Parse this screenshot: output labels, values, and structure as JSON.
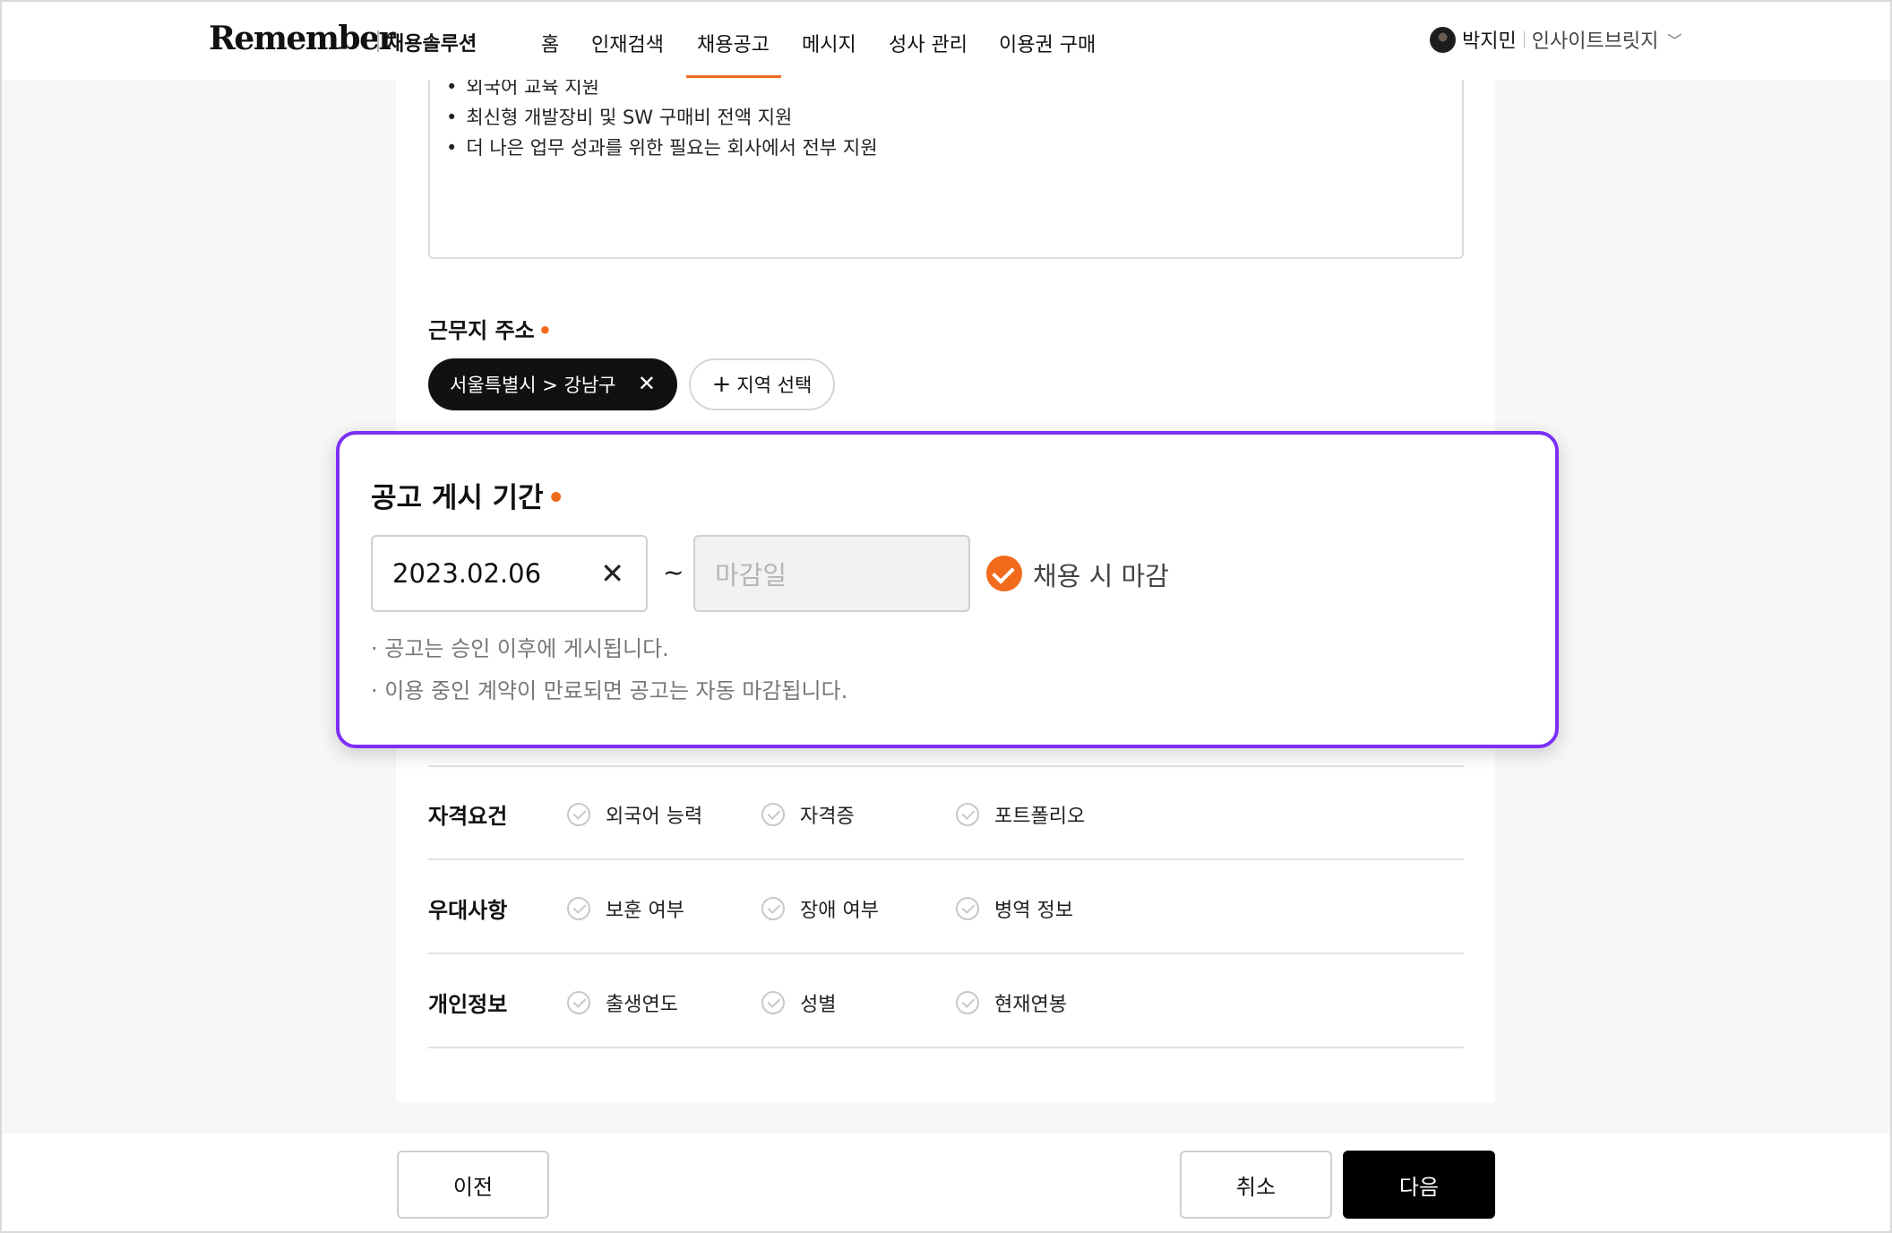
{
  "header": {
    "logo": "Remember",
    "logo_sub": "채용솔루션",
    "nav": [
      "홈",
      "인재검색",
      "채용공고",
      "메시지",
      "성사 관리",
      "이용권 구매"
    ],
    "active_nav": "채용공고",
    "user_name": "박지민",
    "company": "인사이트브릿지"
  },
  "benefits": [
    "외국어 교육 지원",
    "최신형 개발장비 및 SW 구매비 전액 지원",
    "더 나은 업무 성과를 위한 필요는 회사에서 전부 지원"
  ],
  "location": {
    "label": "근무지 주소",
    "selected_chip": "서울특별시 > 강남구",
    "add_button": "지역 선택"
  },
  "posting_period": {
    "title": "공고 게시 기간",
    "start_date": "2023.02.06",
    "end_placeholder": "마감일",
    "close_on_hire_label": "채용 시 마감",
    "close_on_hire_checked": true,
    "notes": [
      "· 공고는 승인 이후에 게시됩니다.",
      "· 이용 중인 계약이 만료되면 공고는 자동 마감됩니다."
    ]
  },
  "option_rows": [
    {
      "label": "자격요건",
      "options": [
        "외국어 능력",
        "자격증",
        "포트폴리오"
      ]
    },
    {
      "label": "우대사항",
      "options": [
        "보훈 여부",
        "장애 여부",
        "병역 정보"
      ]
    },
    {
      "label": "개인정보",
      "options": [
        "출생연도",
        "성별",
        "현재연봉"
      ]
    }
  ],
  "footer": {
    "prev": "이전",
    "cancel": "취소",
    "next": "다음"
  },
  "colors": {
    "accent": "#f26b1d",
    "highlight_border": "#7b2ff7"
  }
}
